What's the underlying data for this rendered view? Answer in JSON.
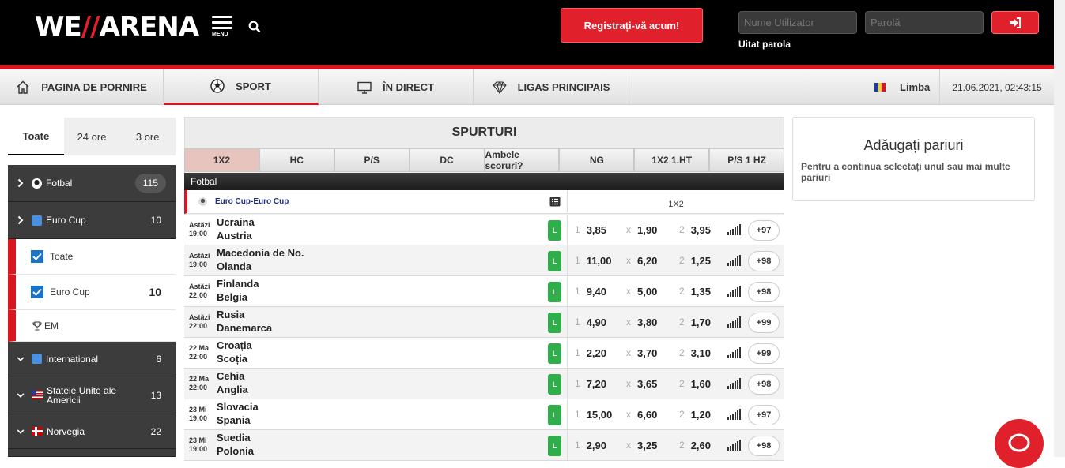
{
  "header": {
    "logo_main": "WE",
    "logo_slash": "//",
    "logo_end": "ARENA",
    "menu_label": "MENU",
    "register_label": "Registrați-vă acum!",
    "username_placeholder": "Nume Utilizator",
    "password_placeholder": "Parolă",
    "forgot_label": "Uitat parola"
  },
  "nav": {
    "items": [
      {
        "label": "PAGINA DE PORNIRE",
        "icon": "home-icon"
      },
      {
        "label": "SPORT",
        "icon": "soccer-ball-icon",
        "active": true
      },
      {
        "label": "ÎN DIRECT",
        "icon": "monitor-icon"
      },
      {
        "label": "LIGAS PRINCIPAIS",
        "icon": "diamond-icon"
      }
    ],
    "language_label": "Limba",
    "datetime": "21.06.2021, 02:43:15"
  },
  "sidebar": {
    "tabs": [
      "Toate",
      "24 ore",
      "3 ore"
    ],
    "fotbal": {
      "label": "Fotbal",
      "count": "115"
    },
    "eurocup": {
      "label": "Euro Cup",
      "count": "10"
    },
    "sub_toate": {
      "label": "Toate"
    },
    "sub_eurocup": {
      "label": "Euro Cup",
      "count": "10"
    },
    "sub_em": {
      "label": "EM"
    },
    "international": {
      "label": "Internațional",
      "count": "6"
    },
    "usa": {
      "label": "Statele Unite ale Americii",
      "count": "13"
    },
    "norway": {
      "label": "Norvegia",
      "count": "22"
    }
  },
  "main": {
    "title": "SPURTURI",
    "tabs": [
      "1X2",
      "HC",
      "P/S",
      "DC",
      "Ambele scoruri?",
      "NG",
      "1X2 1.HT",
      "P/S 1 HZ"
    ],
    "sport_label": "Fotbal",
    "league_label": "Euro Cup-Euro Cup",
    "market_label": "1X2",
    "live_badge": "L",
    "outcome_labels": [
      "1",
      "x",
      "2"
    ],
    "matches": [
      {
        "d1": "Astăzi",
        "d2": "19:00",
        "home": "Ucraina",
        "away": "Austria",
        "o1": "3,85",
        "ox": "1,90",
        "o2": "3,95",
        "more": "+97"
      },
      {
        "d1": "Astăzi",
        "d2": "19:00",
        "home": "Macedonia de No.",
        "away": "Olanda",
        "o1": "11,00",
        "ox": "6,20",
        "o2": "1,25",
        "more": "+98"
      },
      {
        "d1": "Astăzi",
        "d2": "22:00",
        "home": "Finlanda",
        "away": "Belgia",
        "o1": "9,40",
        "ox": "5,00",
        "o2": "1,35",
        "more": "+98"
      },
      {
        "d1": "Astăzi",
        "d2": "22:00",
        "home": "Rusia",
        "away": "Danemarca",
        "o1": "4,90",
        "ox": "3,80",
        "o2": "1,70",
        "more": "+99"
      },
      {
        "d1": "22 Ma",
        "d2": "22:00",
        "home": "Croația",
        "away": "Scoția",
        "o1": "2,20",
        "ox": "3,70",
        "o2": "3,10",
        "more": "+99"
      },
      {
        "d1": "22 Ma",
        "d2": "22:00",
        "home": "Cehia",
        "away": "Anglia",
        "o1": "7,20",
        "ox": "3,65",
        "o2": "1,60",
        "more": "+98"
      },
      {
        "d1": "23 Mi",
        "d2": "19:00",
        "home": "Slovacia",
        "away": "Spania",
        "o1": "15,00",
        "ox": "6,60",
        "o2": "1,20",
        "more": "+97"
      },
      {
        "d1": "23 Mi",
        "d2": "19:00",
        "home": "Suedia",
        "away": "Polonia",
        "o1": "2,90",
        "ox": "3,25",
        "o2": "2,60",
        "more": "+98"
      }
    ]
  },
  "betslip": {
    "title": "Adăugați pariuri",
    "text": "Pentru a continua selectați unul sau mai multe pariuri"
  },
  "colors": {
    "accent": "#e0202a",
    "dark": "#3c3c3c",
    "live": "#2fae4b"
  }
}
